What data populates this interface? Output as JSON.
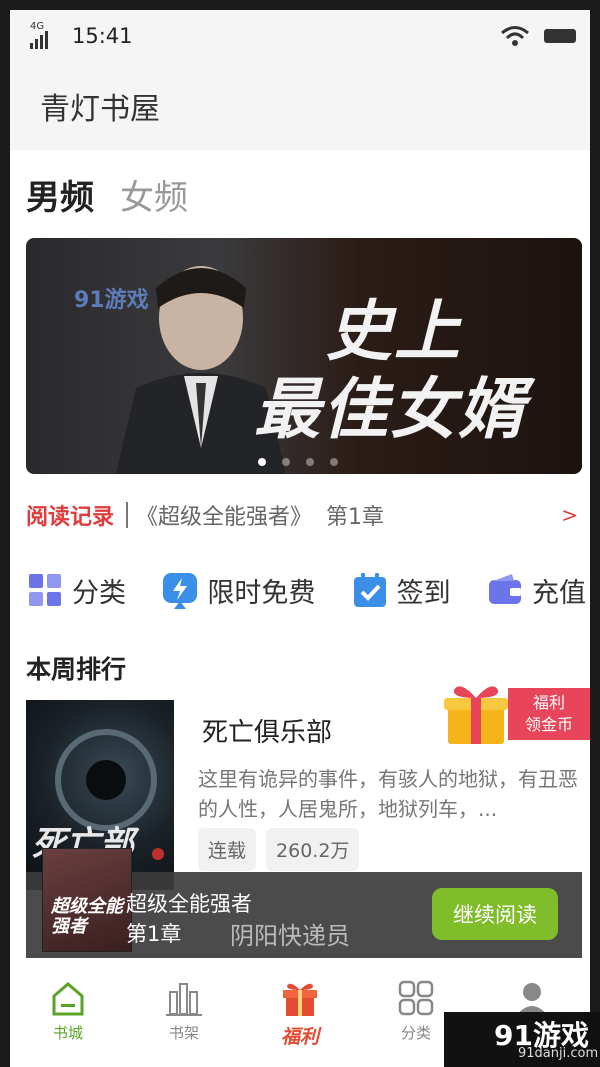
{
  "status": {
    "network": "4G",
    "time": "15:41"
  },
  "app": {
    "title": "青灯书屋"
  },
  "genres": [
    {
      "label": "男频",
      "active": true
    },
    {
      "label": "女频",
      "active": false
    }
  ],
  "banner": {
    "line1": "史上",
    "line2": "最佳女婿",
    "watermark": "91游戏",
    "dots": 4,
    "active_dot": 0
  },
  "record": {
    "label": "阅读记录",
    "book": "《超级全能强者》",
    "chapter": "第1章",
    "arrow": ">"
  },
  "quick": [
    {
      "label": "分类",
      "icon": "grid-icon",
      "color": "#6b74e8"
    },
    {
      "label": "限时免费",
      "icon": "lightning-icon",
      "color": "#3b8fe8"
    },
    {
      "label": "签到",
      "icon": "calendar-check-icon",
      "color": "#3b8fe8"
    },
    {
      "label": "充值",
      "icon": "wallet-icon",
      "color": "#6b74e8"
    }
  ],
  "weekly": {
    "title": "本周排行",
    "book": {
      "name": "死亡俱乐部",
      "cover_text": "死亡部",
      "desc": "这里有诡异的事件，有骇人的地狱，有丑恶的人性，人居鬼所，地狱列车，...",
      "tags": [
        "连载",
        "260.2万"
      ]
    }
  },
  "gift": {
    "line1": "福利",
    "line2": "领金币"
  },
  "player": {
    "title": "超级全能强者",
    "chapter": "第1章",
    "next": "阴阳快递员",
    "button": "继续阅读",
    "cover_text": "超级全能强者"
  },
  "tabs": [
    {
      "label": "书城",
      "icon": "home-icon",
      "active": true
    },
    {
      "label": "书架",
      "icon": "bookshelf-icon",
      "active": false
    },
    {
      "label": "福利",
      "icon": "gift-icon",
      "active": false
    },
    {
      "label": "分类",
      "icon": "category-icon",
      "active": false
    },
    {
      "label": "我的",
      "icon": "user-icon",
      "active": false
    }
  ],
  "watermark": {
    "brand": "91游戏",
    "url": "91danji.com"
  },
  "colors": {
    "accent": "#7fbd2a",
    "record": "#e03c3c",
    "gift": "#e8455b"
  }
}
